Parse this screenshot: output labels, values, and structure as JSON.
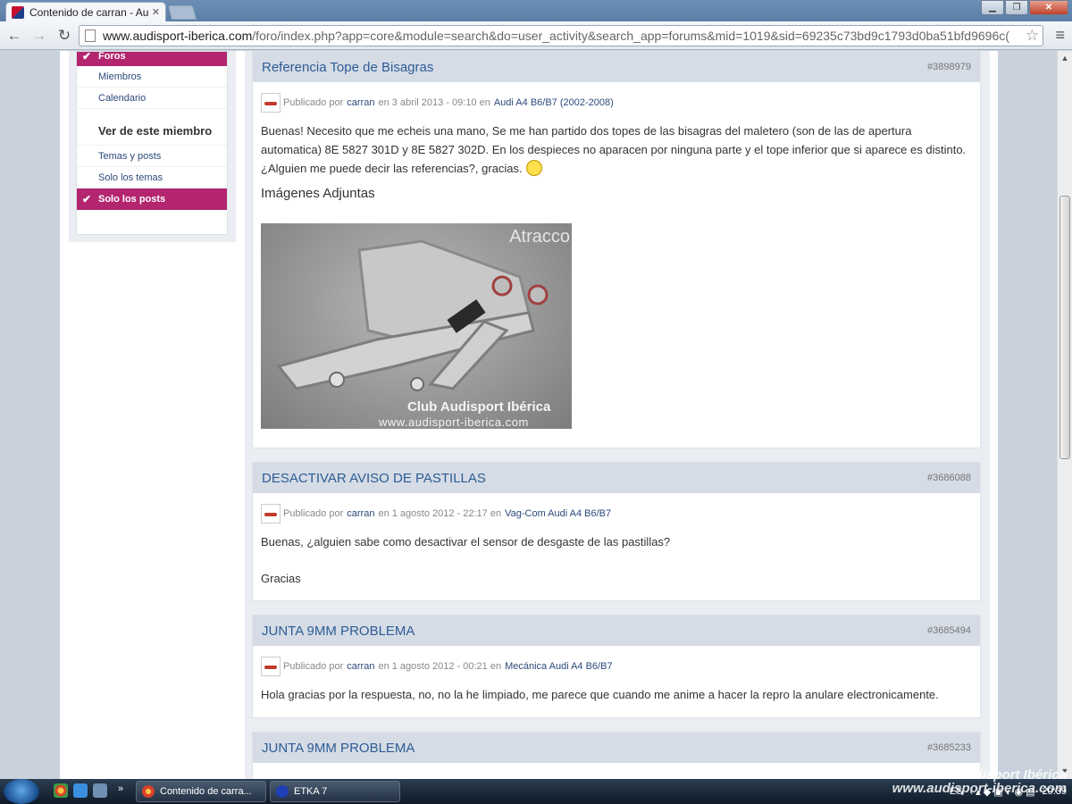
{
  "browser": {
    "tab_title": "Contenido de carran - Au",
    "url_host": "www.audisport-iberica.com",
    "url_path": "/foro/index.php?app=core&module=search&do=user_activity&search_app=forums&mid=1019&sid=69235c73bd9c1793d0ba51bfd9696c("
  },
  "sidebar": {
    "items_top": [
      "Foros",
      "Miembros",
      "Calendario"
    ],
    "heading": "Ver de este miembro",
    "items_bottom": [
      "Temas y posts",
      "Solo los temas",
      "Solo los posts"
    ]
  },
  "posts": [
    {
      "title": "Referencia Tope de Bisagras",
      "id": "#3898979",
      "published_by_label": "Publicado por",
      "author": "carran",
      "date_label": "en 3 abril 2013 - 09:10 en",
      "forum": "Audi A4 B6/B7 (2002-2008)",
      "body": "Buenas! Necesito que me echeis una mano, Se me han partido dos topes de las bisagras del maletero (son de las de apertura automatica) 8E 5827 301D y 8E 5827 302D. En los despieces no aparacen   por ninguna parte y el tope inferior que si aparece es distinto. ¿Alguien me puede decir las referencias?, gracias.",
      "attachments_heading": "Imágenes Adjuntas",
      "image_watermark": "Club Audisport Ibérica",
      "image_url_text": "www.audisport-iberica.com",
      "image_logo": "Atracco"
    },
    {
      "title": "DESACTIVAR AVISO DE PASTILLAS",
      "id": "#3686088",
      "published_by_label": "Publicado por",
      "author": "carran",
      "date_label": "en 1 agosto 2012 - 22:17 en",
      "forum": "Vag-Com Audi A4 B6/B7",
      "body": "Buenas, ¿alguien sabe como desactivar el sensor de desgaste de las pastillas?",
      "body2": "Gracias"
    },
    {
      "title": "JUNTA 9MM PROBLEMA",
      "id": "#3685494",
      "published_by_label": "Publicado por",
      "author": "carran",
      "date_label": "en 1 agosto 2012 - 00:21 en",
      "forum": "Mecánica Audi A4 B6/B7",
      "body": "Hola gracias por la respuesta, no, no la he limpiado, me parece que cuando me anime a hacer la repro la anulare electronicamente."
    },
    {
      "title": "JUNTA 9MM PROBLEMA",
      "id": "#3685233"
    }
  ],
  "taskbar": {
    "tasks": [
      "Contenido de carra...",
      "ETKA 7"
    ],
    "lang": "ES",
    "clock": "20:39"
  },
  "overlay": {
    "brand": "Club Audisport Ibérica",
    "url": "www.audisport-iberica.com"
  }
}
